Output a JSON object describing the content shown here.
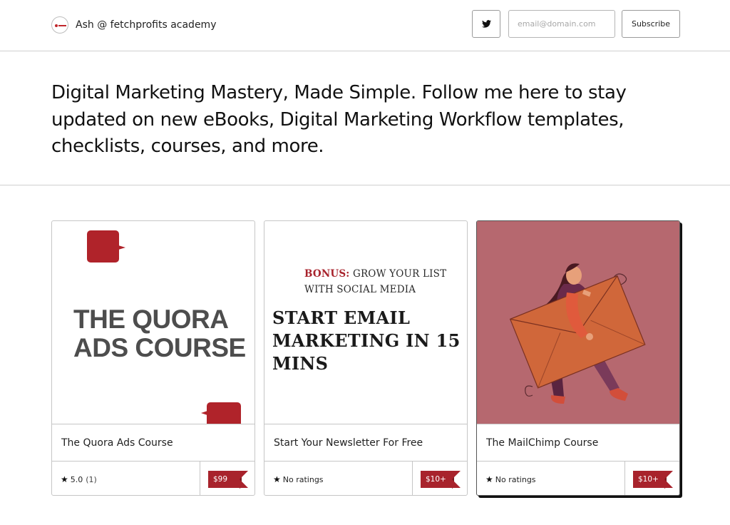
{
  "header": {
    "brand_name": "Ash @ fetchprofits academy",
    "twitter_icon": "twitter-icon",
    "email_placeholder": "email@domain.com",
    "subscribe_label": "Subscribe"
  },
  "intro": {
    "text": "Digital Marketing Mastery, Made Simple. Follow me here to stay updated on new eBooks, Digital Marketing Workflow templates, checklists, courses, and more."
  },
  "products": [
    {
      "cover_title": "THE QUORA ADS COURSE",
      "title": "The Quora Ads Course",
      "rating": "5.0",
      "rating_count": "(1)",
      "price": "$99"
    },
    {
      "cover_bonus_label": "BONUS:",
      "cover_bonus_text": " GROW YOUR LIST WITH SOCIAL MEDIA",
      "cover_title": "START EMAIL MARKETING IN 15 MINS",
      "title": "Start Your Newsletter For Free",
      "rating": "No ratings",
      "price": "$10+"
    },
    {
      "title": "The MailChimp Course",
      "rating": "No ratings",
      "price": "$10+"
    }
  ],
  "colors": {
    "accent": "#a8232c",
    "cover3_bg": "#b6686f"
  }
}
